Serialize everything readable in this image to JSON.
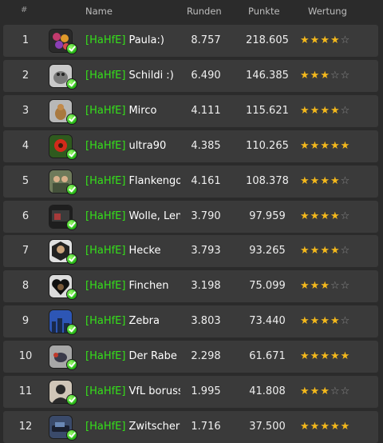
{
  "header": {
    "rank": "#",
    "name": "Name",
    "runden": "Runden",
    "punkte": "Punkte",
    "wertung": "Wertung"
  },
  "colors": {
    "tag": "#35e01a",
    "star": "#f3b81c",
    "row_bg": "#3a3a3a",
    "page_bg": "#2b2b2b"
  },
  "rows": [
    {
      "rank": "1",
      "tag": "[HaHfE]",
      "name": "Paula:)",
      "runden": "8.757",
      "punkte": "218.605",
      "stars": 4,
      "avatar": "flowers"
    },
    {
      "rank": "2",
      "tag": "[HaHfE]",
      "name": "Schildi :)",
      "runden": "6.490",
      "punkte": "146.385",
      "stars": 3,
      "avatar": "gray-creature"
    },
    {
      "rank": "3",
      "tag": "[HaHfE]",
      "name": "Mirco",
      "runden": "4.111",
      "punkte": "115.621",
      "stars": 4,
      "avatar": "bird"
    },
    {
      "rank": "4",
      "tag": "[HaHfE]",
      "name": "ultra90",
      "runden": "4.385",
      "punkte": "110.265",
      "stars": 5,
      "avatar": "red-flower"
    },
    {
      "rank": "5",
      "tag": "[HaHfE]",
      "name": "Flankengo",
      "runden": "4.161",
      "punkte": "108.378",
      "stars": 4,
      "avatar": "people"
    },
    {
      "rank": "6",
      "tag": "[HaHfE]",
      "name": "Wolle, Len",
      "runden": "3.790",
      "punkte": "97.959",
      "stars": 4,
      "avatar": "dark-objects"
    },
    {
      "rank": "7",
      "tag": "[HaHfE]",
      "name": "Hecke",
      "runden": "3.793",
      "punkte": "93.265",
      "stars": 4,
      "avatar": "silhouette-hex"
    },
    {
      "rank": "8",
      "tag": "[HaHfE]",
      "name": "Finchen",
      "runden": "3.198",
      "punkte": "75.099",
      "stars": 3,
      "avatar": "dog-heart"
    },
    {
      "rank": "9",
      "tag": "[HaHfE]",
      "name": "Zebra",
      "runden": "3.803",
      "punkte": "73.440",
      "stars": 4,
      "avatar": "city-blue"
    },
    {
      "rank": "10",
      "tag": "[HaHfE]",
      "name": "Der Rabe",
      "runden": "2.298",
      "punkte": "61.671",
      "stars": 5,
      "avatar": "bird-hand"
    },
    {
      "rank": "11",
      "tag": "[HaHfE]",
      "name": "VfL boruss",
      "runden": "1.995",
      "punkte": "41.808",
      "stars": 3,
      "avatar": "default-person"
    },
    {
      "rank": "12",
      "tag": "[HaHfE]",
      "name": "Zwitscher",
      "runden": "1.716",
      "punkte": "37.500",
      "stars": 5,
      "avatar": "car"
    }
  ]
}
